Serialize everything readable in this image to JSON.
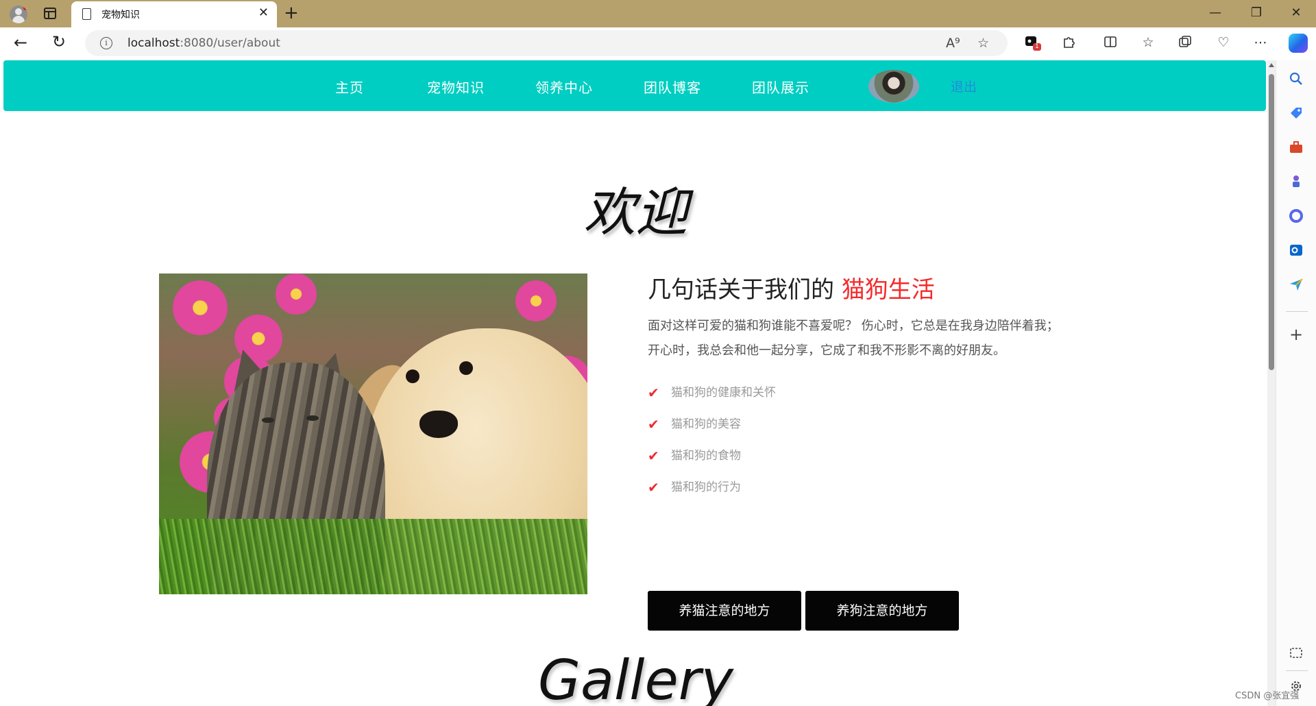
{
  "browser": {
    "tab_title": "宠物知识",
    "tab_close": "✕",
    "new_tab": "+",
    "window_controls": {
      "minimize": "—",
      "restore": "❐",
      "close": "✕"
    },
    "url_host": "localhost",
    "url_rest": ":8080/user/about",
    "info_glyph": "i",
    "extension_badge": "1",
    "icons": [
      "profile-icon",
      "tab-actions-icon",
      "page-icon",
      "back-icon",
      "reload-icon",
      "info-icon",
      "read-aloud-icon",
      "favorite-star-icon",
      "extension-icon",
      "puzzle-icon",
      "split-screen-icon",
      "favorites-icon",
      "collections-icon",
      "browser-essentials-icon",
      "more-icon",
      "copilot-icon"
    ]
  },
  "site_nav": {
    "links": [
      "主页",
      "宠物知识",
      "领养中心",
      "团队博客",
      "团队展示"
    ],
    "logout": "退出",
    "bg_color": "#00cec2",
    "logout_color": "#1f8fd8"
  },
  "main": {
    "welcome": "欢迎",
    "about_title_prefix": "几句话关于我们的 ",
    "about_title_highlight": "猫狗生活",
    "highlight_color": "#f52a2a",
    "about_desc_line1": "面对这样可爱的猫和狗谁能不喜爱呢？ 伤心时，它总是在我身边陪伴着我；",
    "about_desc_line2": "开心时，我总会和他一起分享，它成了和我不形影不离的好朋友。",
    "features": [
      "猫和狗的健康和关怀",
      "猫和狗的美容",
      "猫和狗的食物",
      "猫和狗的行为"
    ],
    "buttons": [
      "养猫注意的地方",
      "养狗注意的地方"
    ],
    "gallery_title": "Gallery"
  },
  "sidebar": {
    "icons": [
      "search-icon",
      "shopping-tag-icon",
      "toolbox-icon",
      "games-icon",
      "microsoft365-icon",
      "outlook-icon",
      "send-icon",
      "add-icon",
      "screenshot-icon",
      "settings-icon"
    ],
    "add": "+"
  },
  "watermark": "CSDN @张宜强"
}
